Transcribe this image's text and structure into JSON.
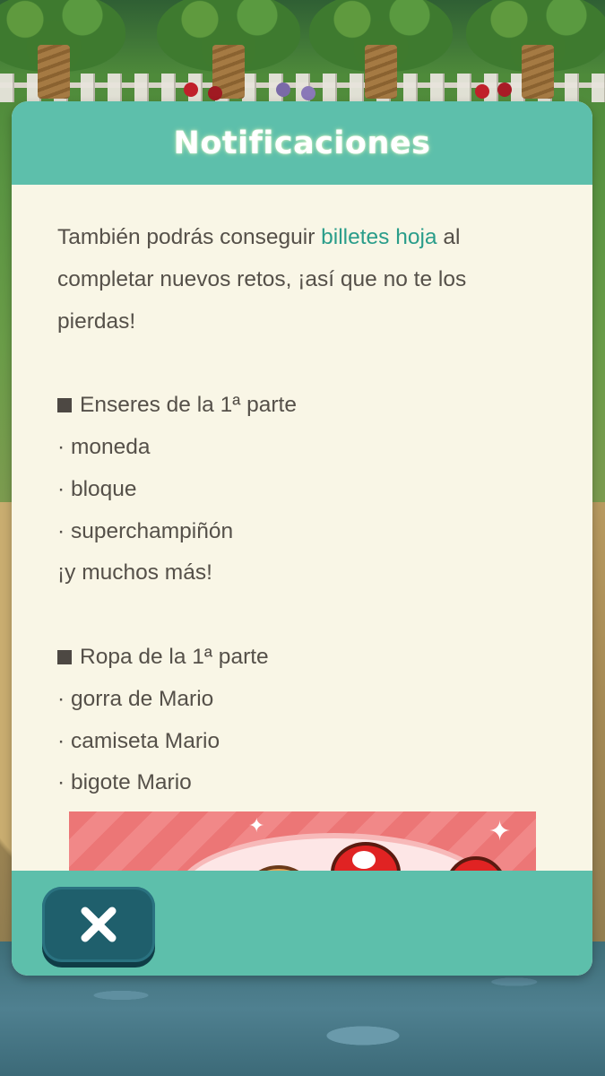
{
  "dialog": {
    "title": "Notificaciones",
    "intro_before": "También podrás conseguir ",
    "intro_highlight": "billetes hoja",
    "intro_line1_after": " al",
    "intro_line2": "completar nuevos retos, ¡así que no te los",
    "intro_line3": "pierdas!",
    "section_items": {
      "heading": "Enseres de la 1ª parte",
      "entries": [
        "· moneda",
        "· bloque",
        "· superchampiñón"
      ],
      "closing": "¡y muchos más!"
    },
    "section_clothing": {
      "heading": "Ropa de la 1ª parte",
      "entries": [
        "· gorra de Mario",
        "· camiseta Mario",
        "· bigote Mario"
      ]
    },
    "close_icon": "close-icon",
    "colors": {
      "header": "#5dbfab",
      "body": "#f9f6e6",
      "highlight": "#2a9d8a",
      "close_button": "#1f5f6c"
    }
  }
}
